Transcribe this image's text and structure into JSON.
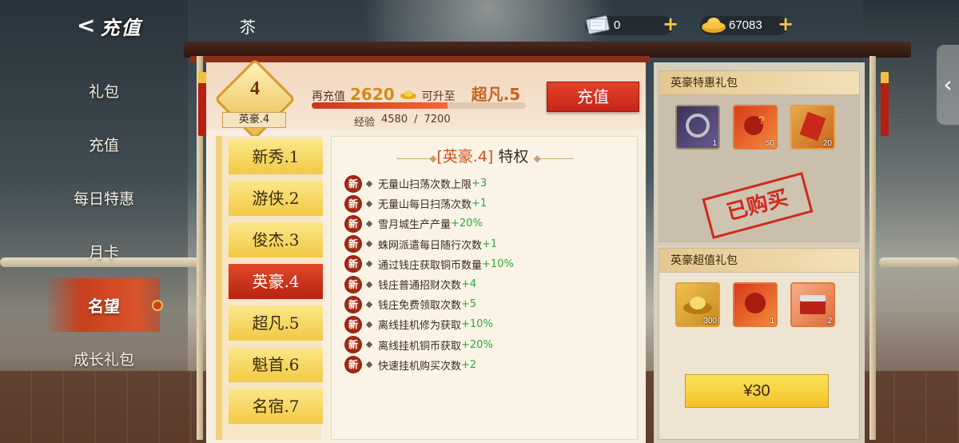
{
  "header": {
    "title": "充值",
    "ornament": "苶",
    "tickets": "0",
    "gold": "67083"
  },
  "nav": {
    "items": [
      "礼包",
      "充值",
      "每日特惠",
      "月卡",
      "名望",
      "成长礼包"
    ],
    "active_index": 4
  },
  "vip": {
    "level": "4",
    "label": "英豪.4",
    "recharge_prefix": "再充值",
    "recharge_amount": "2620",
    "upgrade_text": "可升至",
    "next_tier": "超凡.5",
    "exp_label": "经验",
    "exp_current": "4580",
    "exp_max": "7200",
    "exp_sep": "/",
    "progress_fraction": 0.636,
    "charge_button": "充值"
  },
  "tiers": [
    "新秀.1",
    "游侠.2",
    "俊杰.3",
    "英豪.4",
    "超凡.5",
    "魁首.6",
    "名宿.7"
  ],
  "active_tier_index": 3,
  "privileges": {
    "title_level": "[英豪.4]",
    "title_suffix": "特权",
    "new_tag": "新",
    "rows": [
      {
        "text": "无量山扫荡次数上限",
        "bonus": "+3"
      },
      {
        "text": "无量山每日扫荡次数",
        "bonus": "+1"
      },
      {
        "text": "雪月城生产产量",
        "bonus": "+20%"
      },
      {
        "text": "蛛网派遣每日随行次数",
        "bonus": "+1"
      },
      {
        "text": "通过钱庄获取铜币数量",
        "bonus": "+10%"
      },
      {
        "text": "钱庄普通招财次数",
        "bonus": "+4"
      },
      {
        "text": "钱庄免费领取次数",
        "bonus": "+5"
      },
      {
        "text": "离线挂机修为获取",
        "bonus": "+10%"
      },
      {
        "text": "离线挂机铜币获取",
        "bonus": "+20%"
      },
      {
        "text": "快速挂机购买次数",
        "bonus": "+2"
      }
    ]
  },
  "pack_discount": {
    "title": "英豪特惠礼包",
    "items": [
      {
        "icon": "ring-icon",
        "qty": "1"
      },
      {
        "icon": "red-token-icon",
        "qty": "50"
      },
      {
        "icon": "scroll-icon",
        "qty": "20"
      }
    ],
    "stamp": "已购买"
  },
  "pack_value": {
    "title": "英豪超值礼包",
    "items": [
      {
        "icon": "gold-ingot-icon",
        "qty": "300"
      },
      {
        "icon": "red-token-icon",
        "qty": "1"
      },
      {
        "icon": "chest-icon",
        "qty": "2"
      }
    ],
    "price": "¥30"
  },
  "colors": {
    "accent_red": "#c8401e",
    "gold": "#f2c944",
    "bonus_green": "#2fa83a"
  }
}
